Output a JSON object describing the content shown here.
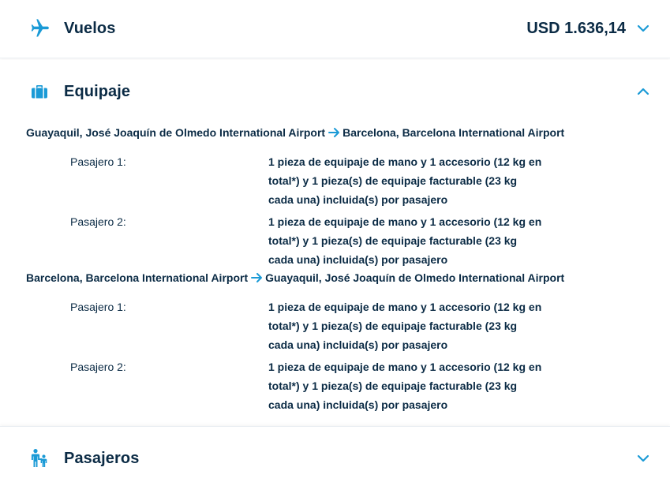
{
  "flights": {
    "title": "Vuelos",
    "price": "USD 1.636,14",
    "icon": "airplane-icon"
  },
  "baggage": {
    "title": "Equipaje",
    "icon": "suitcase-icon",
    "legs": [
      {
        "origin": "Guayaquil, José Joaquín de Olmedo International Airport",
        "destination": "Barcelona, Barcelona International Airport",
        "passengers": [
          {
            "label": "Pasajero 1:",
            "lines": [
              "1 pieza de equipaje de mano y 1 accesorio (12 kg en",
              "total*) y 1 pieza(s) de equipaje facturable (23 kg",
              "cada una) incluida(s) por pasajero"
            ]
          },
          {
            "label": "Pasajero 2:",
            "lines": [
              "1 pieza de equipaje de mano y 1 accesorio (12 kg en",
              "total*) y 1 pieza(s) de equipaje facturable (23 kg",
              "cada una) incluida(s) por pasajero"
            ]
          }
        ]
      },
      {
        "origin": "Barcelona, Barcelona International Airport",
        "destination": "Guayaquil, José Joaquín de Olmedo International Airport",
        "passengers": [
          {
            "label": "Pasajero 1:",
            "lines": [
              "1 pieza de equipaje de mano y 1 accesorio (12 kg en",
              "total*) y 1 pieza(s) de equipaje facturable (23 kg",
              "cada una) incluida(s) por pasajero"
            ]
          },
          {
            "label": "Pasajero 2:",
            "lines": [
              "1 pieza de equipaje de mano y 1 accesorio (12 kg en",
              "total*) y 1 pieza(s) de equipaje facturable (23 kg",
              "cada una) incluida(s) por pasajero"
            ]
          }
        ]
      }
    ]
  },
  "passengers_section": {
    "title": "Pasajeros",
    "icon": "family-icon"
  },
  "colors": {
    "accent": "#1a9ad6",
    "text": "#0b2b45"
  }
}
